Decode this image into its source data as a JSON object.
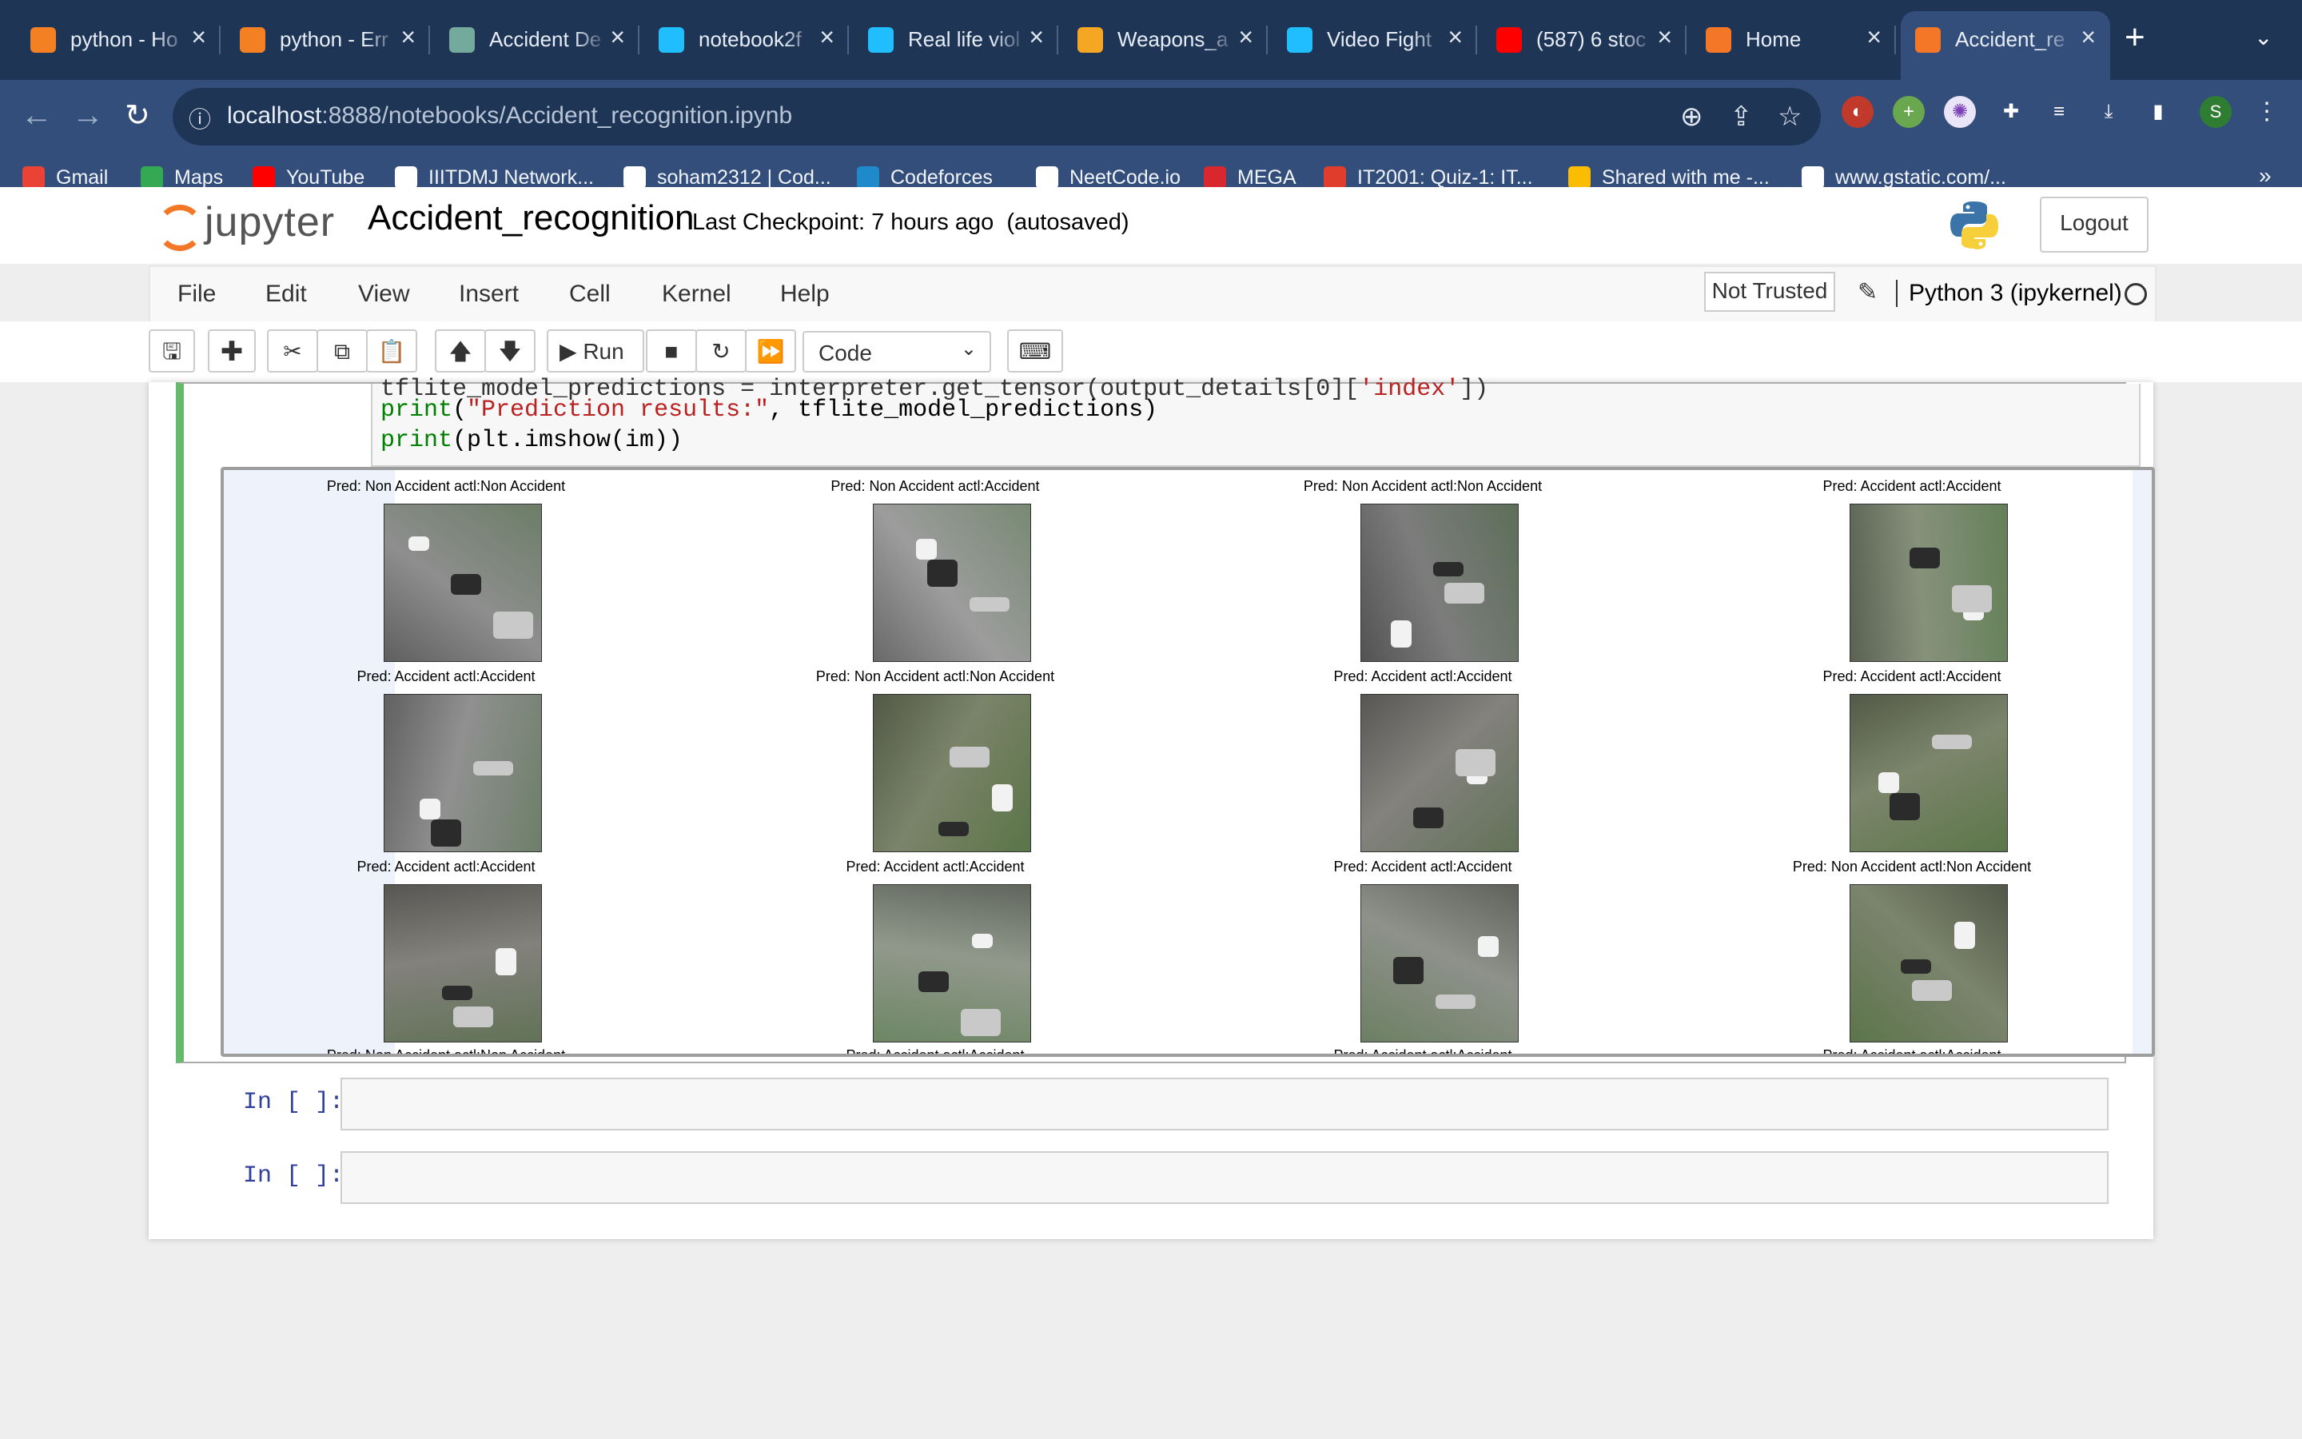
{
  "browser": {
    "tabs": [
      {
        "title": "python - Ho",
        "icon": "stackoverflow-icon",
        "color": "#f48024"
      },
      {
        "title": "python - Err",
        "icon": "stackoverflow-icon",
        "color": "#f48024"
      },
      {
        "title": "Accident De",
        "icon": "openai-icon",
        "color": "#74aa9c"
      },
      {
        "title": "notebook2f",
        "icon": "kaggle-icon",
        "color": "#20beff"
      },
      {
        "title": "Real life viol",
        "icon": "kaggle-icon",
        "color": "#20beff"
      },
      {
        "title": "Weapons_a",
        "icon": "hourglass-icon",
        "color": "#f5a623"
      },
      {
        "title": "Video Fight",
        "icon": "kaggle-icon",
        "color": "#20beff"
      },
      {
        "title": "(587) 6 stoc",
        "icon": "youtube-icon",
        "color": "#ff0000"
      },
      {
        "title": "Home",
        "icon": "jupyter-icon",
        "color": "#f37726"
      },
      {
        "title": "Accident_re",
        "icon": "notebook-icon",
        "color": "#f37726",
        "active": true
      }
    ],
    "url_host": "localhost",
    "url_path": ":8888/notebooks/Accident_recognition.ipynb",
    "bookmarks": [
      {
        "label": "Gmail",
        "icon": "gmail-icon",
        "color": "#ea4335"
      },
      {
        "label": "Maps",
        "icon": "maps-icon",
        "color": "#34a853"
      },
      {
        "label": "YouTube",
        "icon": "youtube-icon",
        "color": "#ff0000"
      },
      {
        "label": "IIITDMJ Network...",
        "icon": "globe-icon",
        "color": "#ffffff"
      },
      {
        "label": "soham2312 | Cod...",
        "icon": "codechef-icon",
        "color": "#ffffff"
      },
      {
        "label": "Codeforces",
        "icon": "codeforces-icon",
        "color": "#1f8acb"
      },
      {
        "label": "NeetCode.io",
        "icon": "rocket-icon",
        "color": "#ffffff"
      },
      {
        "label": "MEGA",
        "icon": "mega-icon",
        "color": "#d9272e"
      },
      {
        "label": "IT2001: Quiz-1: IT...",
        "icon": "canvas-icon",
        "color": "#e13d2d"
      },
      {
        "label": "Shared with me -...",
        "icon": "drive-icon",
        "color": "#fbbc04"
      },
      {
        "label": "www.gstatic.com/...",
        "icon": "globe-icon",
        "color": "#ffffff"
      }
    ],
    "more_bookmarks": "»",
    "profile_initial": "S"
  },
  "jupyter": {
    "logo_text": "jupyter",
    "notebook_name": "Accident_recognition",
    "checkpoint": "Last Checkpoint: 7 hours ago",
    "autosave": "(autosaved)",
    "logout": "Logout",
    "menus": [
      "File",
      "Edit",
      "View",
      "Insert",
      "Cell",
      "Kernel",
      "Help"
    ],
    "not_trusted": "Not Trusted",
    "kernel": "Python 3 (ipykernel)",
    "run_label": "Run",
    "cell_type": "Code",
    "code_lines": [
      {
        "pre": "tflite_model_predictions = interpreter.get_tensor(output_details[0][",
        "str": "'index'",
        "post": "])"
      },
      {
        "fn": "print",
        "open": "(",
        "str": "\"Prediction results:\"",
        "post": ", tflite_model_predictions)"
      },
      {
        "fn": "print",
        "post": "(plt.imshow(im))"
      }
    ],
    "prompt": "In [ ]:"
  },
  "output_panels": [
    {
      "title": "Pred: Non Accident actl:Non Accident",
      "scene": "#8a8a8a"
    },
    {
      "title": "Pred: Non Accident actl:Accident",
      "scene": "#a0a0a0"
    },
    {
      "title": "Pred: Non Accident actl:Non Accident",
      "scene": "#6f6f6f"
    },
    {
      "title": "Pred: Accident actl:Accident",
      "scene": "#7e8f6e"
    },
    {
      "title": "Pred: Accident actl:Accident",
      "scene": "#8d8d8d"
    },
    {
      "title": "Pred: Non Accident actl:Non Accident",
      "scene": "#6c7a52"
    },
    {
      "title": "Pred: Accident actl:Accident",
      "scene": "#7a7770"
    },
    {
      "title": "Pred: Accident actl:Accident",
      "scene": "#6e7d55"
    },
    {
      "title": "Pred: Accident actl:Accident",
      "scene": "#79766e"
    },
    {
      "title": "Pred: Accident actl:Accident",
      "scene": "#8e9a86"
    },
    {
      "title": "Pred: Accident actl:Accident",
      "scene": "#8b8f84"
    },
    {
      "title": "Pred: Non Accident actl:Non Accident",
      "scene": "#6d7a57"
    },
    {
      "title": "Pred: Non Accident actl:Non Accident",
      "scene": "#888888"
    },
    {
      "title": "Pred: Accident actl:Accident",
      "scene": "#888888"
    },
    {
      "title": "Pred: Accident actl:Accident",
      "scene": "#888888"
    },
    {
      "title": "Pred: Accident actl:Accident",
      "scene": "#888888"
    }
  ]
}
